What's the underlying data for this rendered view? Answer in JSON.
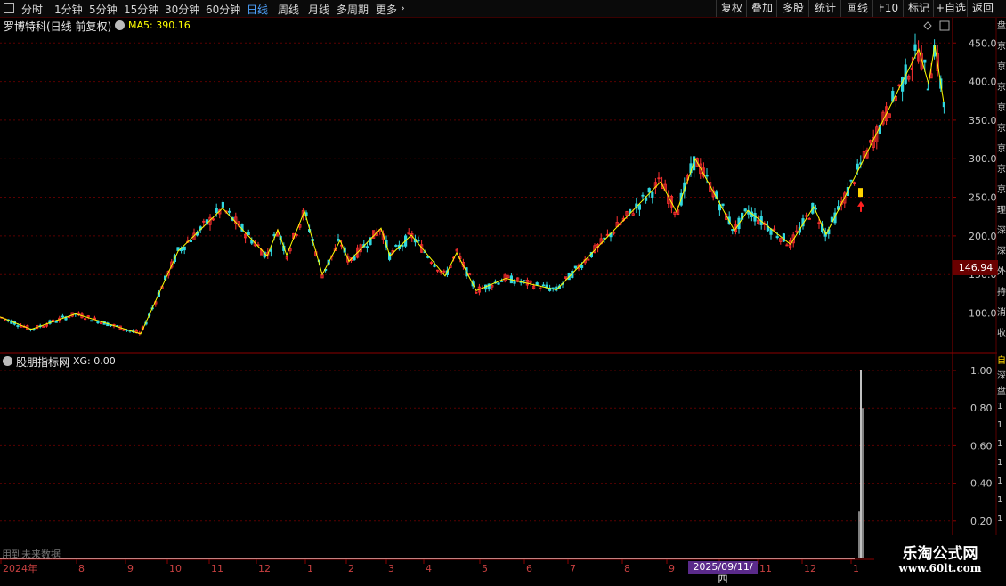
{
  "toolbar": {
    "periods": [
      {
        "label": "分时",
        "active": false
      },
      {
        "label": "1分钟",
        "active": false
      },
      {
        "label": "5分钟",
        "active": false
      },
      {
        "label": "15分钟",
        "active": false
      },
      {
        "label": "30分钟",
        "active": false
      },
      {
        "label": "60分钟",
        "active": false
      },
      {
        "label": "日线",
        "active": true
      },
      {
        "label": "周线",
        "active": false
      },
      {
        "label": "月线",
        "active": false
      },
      {
        "label": "多周期",
        "active": false
      },
      {
        "label": "更多",
        "active": false
      }
    ],
    "actions": [
      "复权",
      "叠加",
      "多股",
      "统计",
      "画线",
      "F10",
      "标记",
      "+自选",
      "返回"
    ]
  },
  "main_panel": {
    "title": "罗博特科(日线 前复权)",
    "ma_label": "MA5: 390.16",
    "current_price_label": "146.94",
    "y_ticks": [
      "450.0",
      "400.0",
      "350.0",
      "300.0",
      "250.0",
      "200.0",
      "150.0",
      "100.0"
    ],
    "zigzag_color": "#ffff00",
    "up_color": "#ff3030",
    "down_color": "#30d8e0"
  },
  "indicator_panel": {
    "title": "股朋指标网",
    "xg_label": "XG: 0.00",
    "y_ticks": [
      "1.00",
      "0.80",
      "0.60",
      "0.40",
      "0.20"
    ],
    "future_note": "用到未来数据",
    "signal_color": "#ffffff"
  },
  "x_axis": {
    "labels": [
      "2024年",
      "8",
      "9",
      "10",
      "11",
      "12",
      "1",
      "2",
      "3",
      "4",
      "5",
      "6",
      "7",
      "8",
      "9",
      "10",
      "11",
      "12",
      "1"
    ],
    "cursor_date": "2025/09/11/四"
  },
  "side_strip": {
    "main_chars": [
      "盘",
      "京",
      "京",
      "京",
      "京",
      "京",
      "京",
      "京",
      "京",
      "理",
      "深",
      "深",
      "外",
      "持",
      "消",
      "收"
    ],
    "ind_chars": [
      "自",
      "深",
      "盘",
      "1",
      "1",
      "1",
      "1",
      "1",
      "1",
      "1",
      "1",
      "1",
      "1"
    ]
  },
  "brand": {
    "name": "乐淘公式网",
    "url": "www.60lt.com"
  },
  "chart_data": {
    "type": "candlestick",
    "title": "罗博特科(日线 前复权)",
    "ylim": [
      65,
      465
    ],
    "zigzag": [
      {
        "x": 0,
        "y": 95
      },
      {
        "x": 35,
        "y": 79
      },
      {
        "x": 85,
        "y": 99
      },
      {
        "x": 158,
        "y": 73
      },
      {
        "x": 200,
        "y": 180
      },
      {
        "x": 250,
        "y": 236
      },
      {
        "x": 300,
        "y": 174
      },
      {
        "x": 312,
        "y": 208
      },
      {
        "x": 322,
        "y": 175
      },
      {
        "x": 342,
        "y": 232
      },
      {
        "x": 362,
        "y": 150
      },
      {
        "x": 382,
        "y": 194
      },
      {
        "x": 392,
        "y": 167
      },
      {
        "x": 428,
        "y": 210
      },
      {
        "x": 438,
        "y": 174
      },
      {
        "x": 462,
        "y": 201
      },
      {
        "x": 500,
        "y": 148
      },
      {
        "x": 513,
        "y": 178
      },
      {
        "x": 535,
        "y": 129
      },
      {
        "x": 568,
        "y": 145
      },
      {
        "x": 625,
        "y": 130
      },
      {
        "x": 742,
        "y": 270
      },
      {
        "x": 760,
        "y": 231
      },
      {
        "x": 781,
        "y": 300
      },
      {
        "x": 825,
        "y": 207
      },
      {
        "x": 840,
        "y": 233
      },
      {
        "x": 888,
        "y": 189
      },
      {
        "x": 914,
        "y": 238
      },
      {
        "x": 928,
        "y": 202
      },
      {
        "x": 1032,
        "y": 442
      },
      {
        "x": 1043,
        "y": 397
      },
      {
        "x": 1050,
        "y": 447
      },
      {
        "x": 1060,
        "y": 373
      }
    ],
    "signal": {
      "cursor_date": "2025/09/11/四",
      "XG_peak": 1.0,
      "XG_current": 0.0
    }
  }
}
